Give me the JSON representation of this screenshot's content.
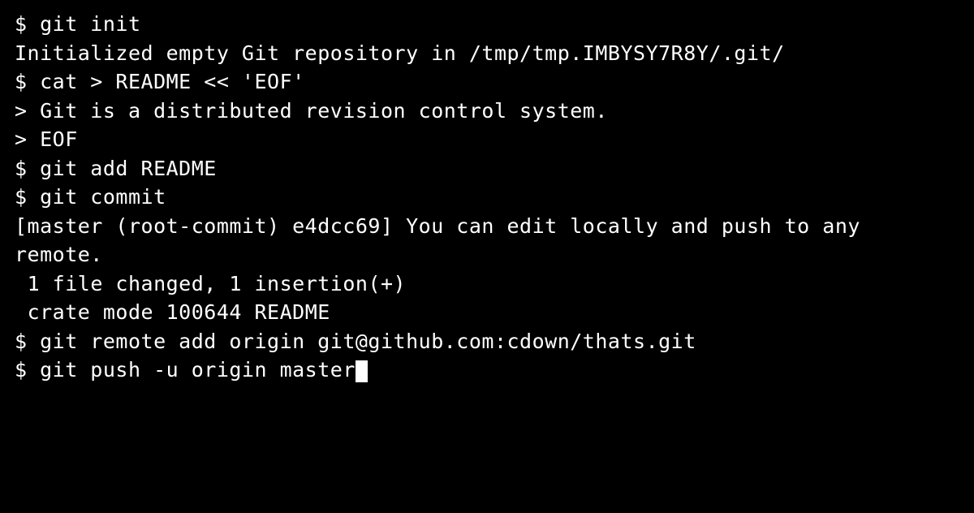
{
  "terminal": {
    "prompt": "$ ",
    "heredoc_prompt": "> ",
    "lines": [
      {
        "type": "cmd",
        "text": "git init"
      },
      {
        "type": "out",
        "text": "Initialized empty Git repository in /tmp/tmp.IMBYSY7R8Y/.git/"
      },
      {
        "type": "cmd",
        "text": "cat > README << 'EOF'"
      },
      {
        "type": "heredoc",
        "text": "Git is a distributed revision control system."
      },
      {
        "type": "heredoc",
        "text": "EOF"
      },
      {
        "type": "cmd",
        "text": "git add README"
      },
      {
        "type": "cmd",
        "text": "git commit"
      },
      {
        "type": "out",
        "text": "[master (root-commit) e4dcc69] You can edit locally and push to any remote."
      },
      {
        "type": "out",
        "text": " 1 file changed, 1 insertion(+)"
      },
      {
        "type": "out",
        "text": " crate mode 100644 README"
      },
      {
        "type": "cmd",
        "text": "git remote add origin git@github.com:cdown/thats.git"
      },
      {
        "type": "cmd",
        "text": "git push -u origin master",
        "cursor": true
      }
    ]
  }
}
